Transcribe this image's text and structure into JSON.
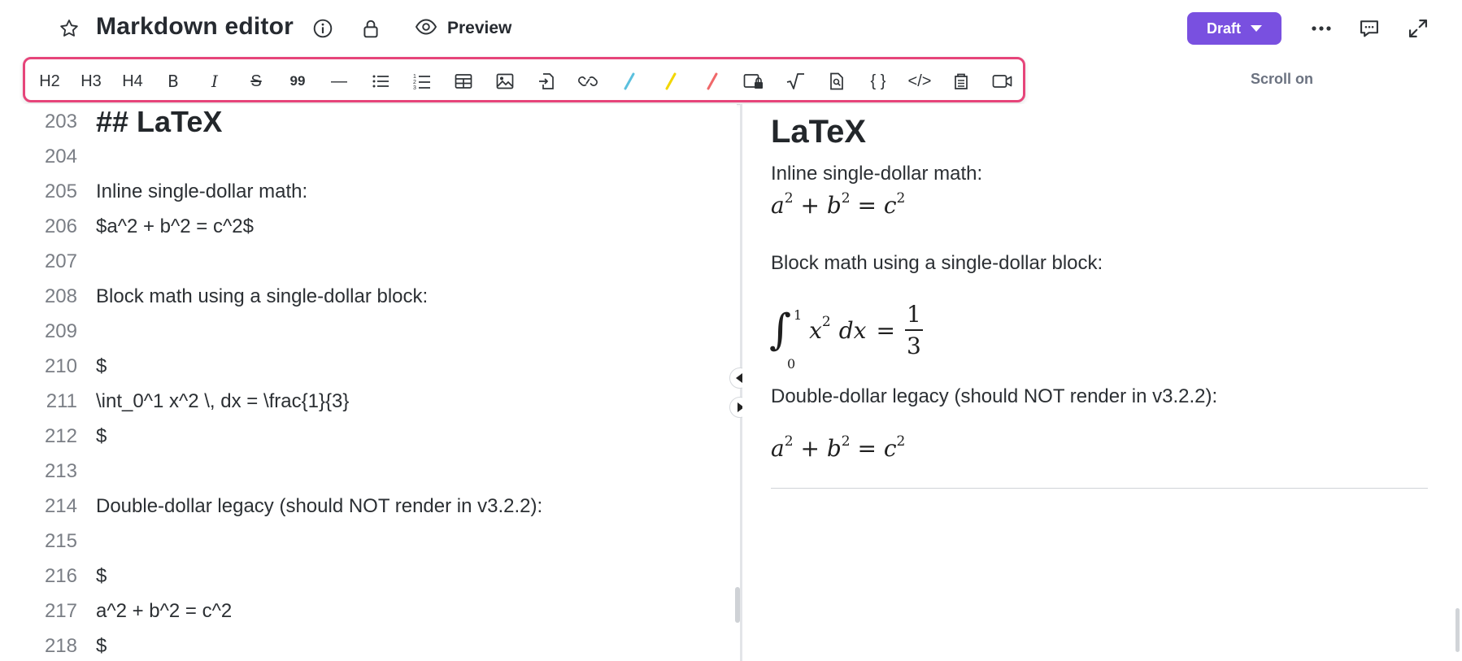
{
  "header": {
    "title": "Markdown editor",
    "preview_label": "Preview",
    "status_label": "Draft"
  },
  "toolbar": {
    "items": [
      {
        "label": "H2",
        "icon": "heading-2-icon"
      },
      {
        "label": "H3",
        "icon": "heading-3-icon"
      },
      {
        "label": "H4",
        "icon": "heading-4-icon"
      },
      {
        "label": "B",
        "icon": "bold-icon"
      },
      {
        "label": "I",
        "icon": "italic-icon"
      },
      {
        "label": "S",
        "icon": "strikethrough-icon"
      },
      {
        "label": "99",
        "icon": "quote-icon"
      },
      {
        "label": "—",
        "icon": "horizontal-rule-icon"
      },
      {
        "icon": "bullet-list-icon"
      },
      {
        "icon": "numbered-list-icon"
      },
      {
        "icon": "table-icon"
      },
      {
        "icon": "image-icon"
      },
      {
        "icon": "insert-file-icon"
      },
      {
        "icon": "link-icon"
      },
      {
        "icon": "highlight-blue-icon",
        "color": "#5bc0de"
      },
      {
        "icon": "highlight-yellow-icon",
        "color": "#f2d600"
      },
      {
        "icon": "highlight-red-icon",
        "color": "#f0686a"
      },
      {
        "icon": "locked-content-icon"
      },
      {
        "icon": "math-sqrt-icon"
      },
      {
        "icon": "search-document-icon"
      },
      {
        "label": "{ }",
        "icon": "code-block-icon"
      },
      {
        "label": "</>",
        "icon": "html-icon"
      },
      {
        "icon": "clipboard-icon"
      },
      {
        "icon": "video-icon"
      }
    ],
    "scroll_label": "Scroll on"
  },
  "editor": {
    "lines": [
      {
        "num": "203",
        "text": "## LaTeX",
        "style": "h2"
      },
      {
        "num": "204",
        "text": ""
      },
      {
        "num": "205",
        "text": "Inline single-dollar math:"
      },
      {
        "num": "206",
        "text": "$a^2 + b^2 = c^2$"
      },
      {
        "num": "207",
        "text": ""
      },
      {
        "num": "208",
        "text": "Block math using a single-dollar block:"
      },
      {
        "num": "209",
        "text": ""
      },
      {
        "num": "210",
        "text": "$"
      },
      {
        "num": "211",
        "text": "\\int_0^1 x^2 \\, dx = \\frac{1}{3}"
      },
      {
        "num": "212",
        "text": "$"
      },
      {
        "num": "213",
        "text": ""
      },
      {
        "num": "214",
        "text": "Double-dollar legacy (should NOT render in v3.2.2):"
      },
      {
        "num": "215",
        "text": ""
      },
      {
        "num": "216",
        "text": "$"
      },
      {
        "num": "217",
        "text": "a^2 + b^2 = c^2"
      },
      {
        "num": "218",
        "text": "$"
      }
    ]
  },
  "preview": {
    "heading": "LaTeX",
    "p1": "Inline single-dollar math:",
    "p2": "Block math using a single-dollar block:",
    "p3": "Double-dollar legacy (should NOT render in v3.2.2):",
    "math_inline": {
      "a": "a",
      "b": "b",
      "c": "c",
      "exp": "2",
      "plus": "+",
      "eq": "="
    },
    "math_block": {
      "integral": "∫",
      "lower": "0",
      "upper": "1",
      "body": "x",
      "exp": "2",
      "dx": "dx",
      "eq": "=",
      "num": "1",
      "den": "3"
    }
  },
  "colors": {
    "accent": "#7950e0",
    "toolbar_highlight_border": "#e6457a"
  }
}
